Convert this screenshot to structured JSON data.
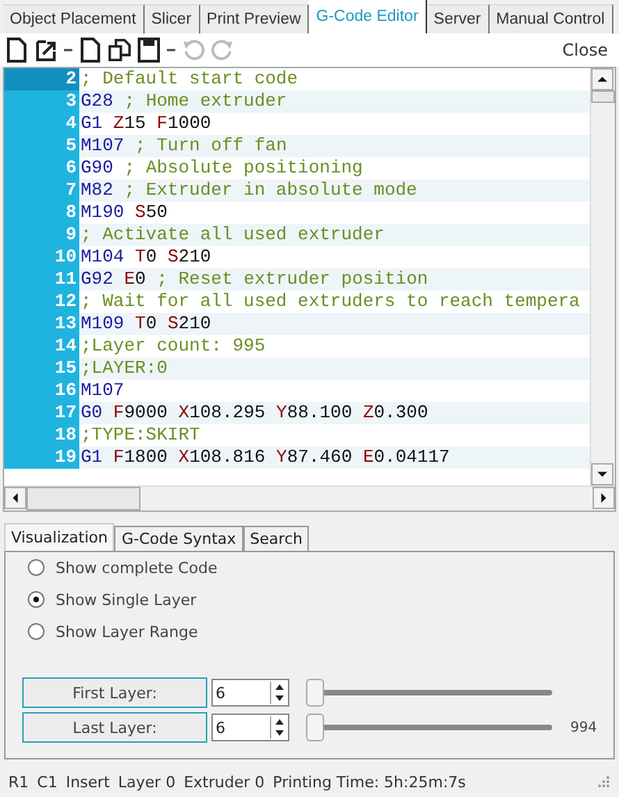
{
  "tabs": [
    {
      "label": "Object Placement",
      "selected": false
    },
    {
      "label": "Slicer",
      "selected": false
    },
    {
      "label": "Print Preview",
      "selected": false
    },
    {
      "label": "G-Code Editor",
      "selected": true
    },
    {
      "label": "Server",
      "selected": false
    },
    {
      "label": "Manual Control",
      "selected": false
    }
  ],
  "toolbar": {
    "close": "Close"
  },
  "editor": {
    "lines": [
      {
        "number": "2",
        "current": true,
        "tokens": [
          {
            "kind": "comment",
            "text": "; Default start code"
          }
        ]
      },
      {
        "number": "3",
        "current": false,
        "tokens": [
          {
            "kind": "cmd",
            "text": "G28"
          },
          {
            "kind": "comment",
            "text": "; Home extruder"
          }
        ]
      },
      {
        "number": "4",
        "current": false,
        "tokens": [
          {
            "kind": "cmd",
            "text": "G1"
          },
          {
            "kind": "param",
            "text": "Z15"
          },
          {
            "kind": "param",
            "text": "F1000"
          }
        ]
      },
      {
        "number": "5",
        "current": false,
        "tokens": [
          {
            "kind": "cmd",
            "text": "M107"
          },
          {
            "kind": "comment",
            "text": "; Turn off fan"
          }
        ]
      },
      {
        "number": "6",
        "current": false,
        "tokens": [
          {
            "kind": "cmd",
            "text": "G90"
          },
          {
            "kind": "comment",
            "text": "; Absolute positioning"
          }
        ]
      },
      {
        "number": "7",
        "current": false,
        "tokens": [
          {
            "kind": "cmd",
            "text": "M82"
          },
          {
            "kind": "comment",
            "text": "; Extruder in absolute mode"
          }
        ]
      },
      {
        "number": "8",
        "current": false,
        "tokens": [
          {
            "kind": "cmd",
            "text": "M190"
          },
          {
            "kind": "param",
            "text": "S50"
          }
        ]
      },
      {
        "number": "9",
        "current": false,
        "tokens": [
          {
            "kind": "comment",
            "text": "; Activate all used extruder"
          }
        ]
      },
      {
        "number": "10",
        "current": false,
        "tokens": [
          {
            "kind": "cmd",
            "text": "M104"
          },
          {
            "kind": "param",
            "text": "T0"
          },
          {
            "kind": "param",
            "text": "S210"
          }
        ]
      },
      {
        "number": "11",
        "current": false,
        "tokens": [
          {
            "kind": "cmd",
            "text": "G92"
          },
          {
            "kind": "param",
            "text": "E0"
          },
          {
            "kind": "comment",
            "text": "; Reset extruder position"
          }
        ]
      },
      {
        "number": "12",
        "current": false,
        "tokens": [
          {
            "kind": "comment",
            "text": "; Wait for all used extruders to reach tempera"
          }
        ]
      },
      {
        "number": "13",
        "current": false,
        "tokens": [
          {
            "kind": "cmd",
            "text": "M109"
          },
          {
            "kind": "param",
            "text": "T0"
          },
          {
            "kind": "param",
            "text": "S210"
          }
        ]
      },
      {
        "number": "14",
        "current": false,
        "tokens": [
          {
            "kind": "comment",
            "text": ";Layer count: 995"
          }
        ]
      },
      {
        "number": "15",
        "current": false,
        "tokens": [
          {
            "kind": "comment",
            "text": ";LAYER:0"
          }
        ]
      },
      {
        "number": "16",
        "current": false,
        "tokens": [
          {
            "kind": "cmd",
            "text": "M107"
          }
        ]
      },
      {
        "number": "17",
        "current": false,
        "tokens": [
          {
            "kind": "cmd",
            "text": "G0"
          },
          {
            "kind": "param",
            "text": "F9000"
          },
          {
            "kind": "param",
            "text": "X108.295"
          },
          {
            "kind": "param",
            "text": "Y88.100"
          },
          {
            "kind": "param",
            "text": "Z0.300"
          }
        ]
      },
      {
        "number": "18",
        "current": false,
        "tokens": [
          {
            "kind": "comment",
            "text": ";TYPE:SKIRT"
          }
        ]
      },
      {
        "number": "19",
        "current": false,
        "tokens": [
          {
            "kind": "cmd",
            "text": "G1"
          },
          {
            "kind": "param",
            "text": "F1800"
          },
          {
            "kind": "param",
            "text": "X108.816"
          },
          {
            "kind": "param",
            "text": "Y87.460"
          },
          {
            "kind": "param",
            "text": "E0.04117"
          }
        ]
      }
    ]
  },
  "lower_tabs": [
    {
      "label": "Visualization",
      "selected": true
    },
    {
      "label": "G-Code Syntax",
      "selected": false
    },
    {
      "label": "Search",
      "selected": false
    }
  ],
  "visualization": {
    "options": [
      {
        "label": "Show complete Code",
        "selected": false
      },
      {
        "label": "Show Single Layer",
        "selected": true
      },
      {
        "label": "Show Layer Range",
        "selected": false
      }
    ],
    "layers": [
      {
        "label": "First Layer:",
        "value": "6",
        "level": 0.0
      },
      {
        "label": "Last Layer:",
        "value": "6",
        "level": 0.0,
        "reading": "994"
      }
    ]
  },
  "status_bar": [
    "R1",
    "C1",
    "Insert",
    "Layer 0",
    "Extruder 0",
    "Printing Time: 5h:25m:7s"
  ]
}
